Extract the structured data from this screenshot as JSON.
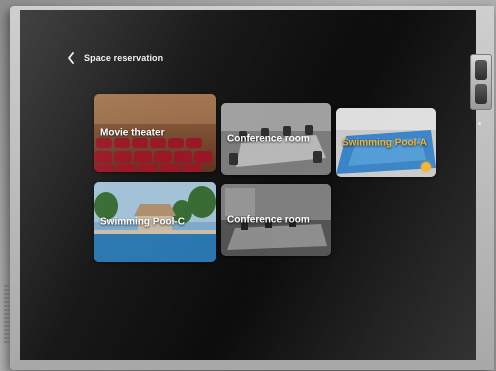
{
  "screen": {
    "title": "Space reservation",
    "back_icon": "chevron-left-icon"
  },
  "rooms": [
    {
      "label": "Movie theater"
    },
    {
      "label": "Conference room"
    },
    {
      "label": "Swimming Pool-A",
      "selected": true
    },
    {
      "label": "Swimming Pool-C"
    },
    {
      "label": "Conference room"
    }
  ],
  "colors": {
    "accent_badge": "#f2b233",
    "screen_bg": "#141414",
    "text": "#ffffff"
  }
}
